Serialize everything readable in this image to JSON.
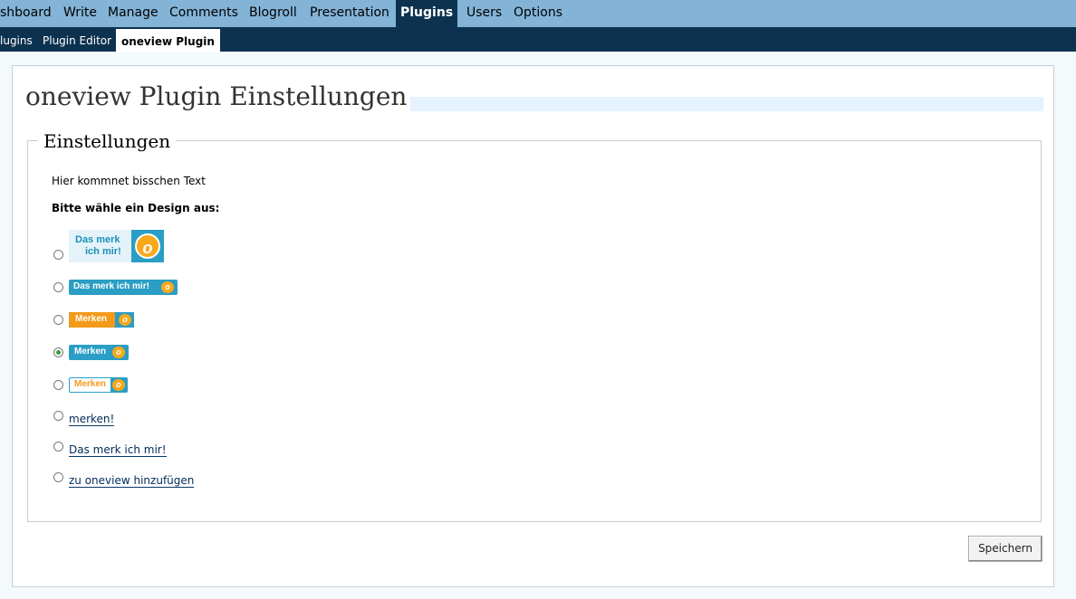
{
  "top_nav": [
    {
      "label": "shboard"
    },
    {
      "label": "Write"
    },
    {
      "label": "Manage"
    },
    {
      "label": "Comments"
    },
    {
      "label": "Blogroll"
    },
    {
      "label": "Presentation"
    },
    {
      "label": "Plugins",
      "active": true
    },
    {
      "label": "Users"
    },
    {
      "label": "Options"
    }
  ],
  "sub_nav": [
    {
      "label": "lugins"
    },
    {
      "label": "Plugin Editor"
    },
    {
      "label": "oneview Plugin",
      "active": true
    }
  ],
  "page": {
    "title": "oneview Plugin Einstellungen",
    "fieldset_legend": "Einstellungen",
    "intro_text": "Hier kommnet bisschen Text",
    "design_label": "Bitte wähle ein Design aus:",
    "save_label": "Speichern"
  },
  "design_options": [
    {
      "kind": "image",
      "text_line1": "Das merk",
      "text_line2": "ich mir!",
      "badge": "o",
      "selected": false
    },
    {
      "kind": "image",
      "text": "Das merk ich mir!",
      "badge": "o",
      "selected": false
    },
    {
      "kind": "image",
      "text": "Merken",
      "badge": "o",
      "selected": false
    },
    {
      "kind": "image",
      "text": "Merken",
      "badge": "o",
      "selected": true
    },
    {
      "kind": "image",
      "text": "Merken",
      "badge": "o",
      "selected": false
    },
    {
      "kind": "link",
      "text": "merken!",
      "selected": false
    },
    {
      "kind": "link",
      "text": "Das merk ich mir!",
      "selected": false
    },
    {
      "kind": "link",
      "text": "zu oneview hinzufügen",
      "selected": false
    }
  ],
  "colors": {
    "top_nav_bg": "#83b4d8",
    "sub_nav_bg": "#0d324f",
    "oneview_blue": "#2a9ec4",
    "oneview_orange": "#f7a81b"
  }
}
